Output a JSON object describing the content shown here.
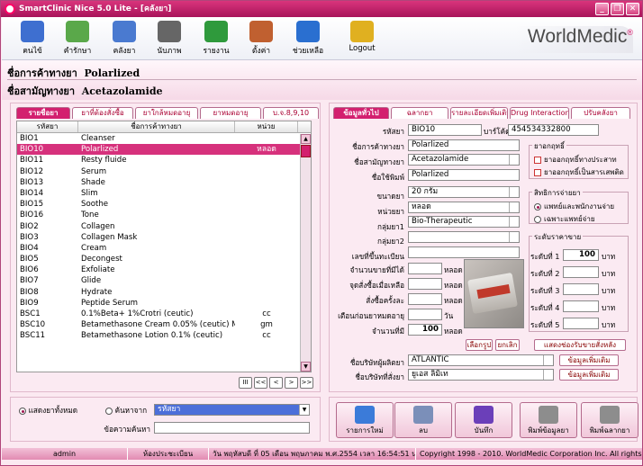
{
  "window": {
    "title": "SmartClinic Nice 5.0 Lite - [คลังยา]"
  },
  "toolbar": {
    "items": [
      {
        "label": "คนไข้",
        "icon": "patient-icon"
      },
      {
        "label": "คำรักษา",
        "icon": "treatment-icon"
      },
      {
        "label": "คลังยา",
        "icon": "pill-icon"
      },
      {
        "label": "นับภาพ",
        "icon": "camera-icon"
      },
      {
        "label": "รายงาน",
        "icon": "chart-icon"
      },
      {
        "label": "ตั้งค่า",
        "icon": "tools-icon"
      },
      {
        "label": "ช่วยเหลือ",
        "icon": "help-icon"
      },
      {
        "label": "Logout",
        "icon": "lock-icon"
      }
    ],
    "brand": "WorldMedic",
    "brand_mark": "®"
  },
  "header": {
    "trade_name_label": "ชื่อการค้าทางยา",
    "trade_name": "Polarlized",
    "generic_name_label": "ชื่อสามัญทางยา",
    "generic_name": "Acetazolamide"
  },
  "left_tabs": [
    "รายชื่อยา",
    "ยาที่ต้องสั่งซื้อ",
    "ยาใกล้หมดอายุ",
    "ยาหมดอายุ",
    "บ.จ.8,9,10"
  ],
  "list": {
    "headers": [
      "รหัสยา",
      "ชื่อการค้าทางยา",
      "หน่วย"
    ],
    "rows": [
      [
        "BIO1",
        "Cleanser",
        ""
      ],
      [
        "BIO10",
        "Polarlized",
        "หลอด"
      ],
      [
        "BIO11",
        "Resty fluide",
        ""
      ],
      [
        "BIO12",
        "Serum",
        ""
      ],
      [
        "BIO13",
        "Shade",
        ""
      ],
      [
        "BIO14",
        "Slim",
        ""
      ],
      [
        "BIO15",
        "Soothe",
        ""
      ],
      [
        "BIO16",
        "Tone",
        ""
      ],
      [
        "BIO2",
        "Collagen",
        ""
      ],
      [
        "BIO3",
        "Collagen Mask",
        ""
      ],
      [
        "BIO4",
        "Cream",
        ""
      ],
      [
        "BIO5",
        "Decongest",
        ""
      ],
      [
        "BIO6",
        "Exfoliate",
        ""
      ],
      [
        "BIO7",
        "Glide",
        ""
      ],
      [
        "BIO8",
        "Hydrate",
        ""
      ],
      [
        "BIO9",
        "Peptide Serum",
        ""
      ],
      [
        "BSC1",
        "0.1%Beta+ 1%Crotri (ceutic)",
        "cc"
      ],
      [
        "BSC10",
        "Betamethasone Cream 0.05% (ceutic) MIN",
        "gm"
      ],
      [
        "BSC11",
        "Betamethasone Lotion 0.1% (ceutic)",
        "cc"
      ]
    ],
    "selected_index": 1
  },
  "nav_buttons": [
    "III",
    "<<",
    "<",
    ">",
    ">>"
  ],
  "filter": {
    "show_all": "แสดงยาทั้งหมด",
    "search_by": "ค้นหาจาก",
    "search_field": "รหัสยา",
    "keyword_label": "ข้อความค้นหา",
    "keyword": ""
  },
  "right_tabs": [
    "ข้อมูลทั่วไป",
    "ฉลากยา",
    "รายละเอียดเพิ่มเติม",
    "Drug Interaction",
    "ปรับคลังยา"
  ],
  "form": {
    "code_label": "รหัสยา",
    "code": "BIO10",
    "barcode_label": "บาร์โค้ด",
    "barcode": "454534332800",
    "trade_label": "ชื่อการค้าทางยา",
    "trade": "Polarlized",
    "generic_label": "ชื่อสามัญทางยา",
    "generic": "Acetazolamide",
    "print_label": "ชื่อใช้พิมพ์",
    "print": "Polarlized",
    "size_label": "ขนาดยา",
    "size": "20 กรัม",
    "unit_label": "หน่วยยา",
    "unit": "หลอด",
    "group1_label": "กลุ่มยา1",
    "group1": "Bio-Therapeutic",
    "group2_label": "กลุ่มยา2",
    "group2": "",
    "reg_label": "เลขที่ขึ้นทะเบียน",
    "reg": "",
    "min_label": "จำนวนขายที่มีได้",
    "min": "",
    "reorder_label": "จุดสั่งซื้อเมื่อเหลือ",
    "reorder": "",
    "order_label": "สั่งซื้อครั้งละ",
    "order": "",
    "expire_label": "เตือนก่อนยาหมดอายุ",
    "expire": "",
    "stock_label": "จำนวนที่มี",
    "stock": "100",
    "unit_suffix": "หลอด",
    "day_suffix": "วัน",
    "pick_image": "เลือกรูป",
    "cancel_image": "ยกเลิก",
    "drug_group_title": "ยาอกฤทธิ์",
    "check1": "ยาออกฤทธิ์ทางประสาท",
    "check2": "ยาออกฤทธิ์เป็นสารเสพติด",
    "rights_title": "สิทธิการจ่ายยา",
    "right1": "แพทย์และพนักงานจ่าย",
    "right2": "เฉพาะแพทย์จ่าย",
    "price_title": "ระดับราคาขาย",
    "price_levels": [
      "ระดับที่ 1",
      "ระดับที่ 2",
      "ระดับที่ 3",
      "ระดับที่ 4",
      "ระดับที่ 5"
    ],
    "price_values": [
      "100",
      "",
      "",
      "",
      ""
    ],
    "baht": "บาท",
    "show_loc": "แสดงช่องรับขายสั่งหลัง",
    "maker_label": "ชื่อบริษัทผู้ผลิตยา",
    "maker": "ATLANTIC",
    "seller_label": "ชื่อบริษัทที่สั่งยา",
    "seller": "ยูเอส ลิมิเท",
    "more_info": "ข้อมูลเพิ่มเติม"
  },
  "actions": [
    "รายการใหม่",
    "ลบ",
    "บันทึก",
    "พิมพ์ข้อมูลยา",
    "พิมพ์ฉลากยา"
  ],
  "status": {
    "user": "admin",
    "room": "ห้องประชะเบียน",
    "date": "วัน พฤหัสบดี ที่ 05 เดือน พฤษภาคม พ.ศ.2554 เวลา 16:54:51 น.",
    "copyright": "Copyright 1998 - 2010. WorldMedic Corporation Inc. All rights reserved."
  }
}
